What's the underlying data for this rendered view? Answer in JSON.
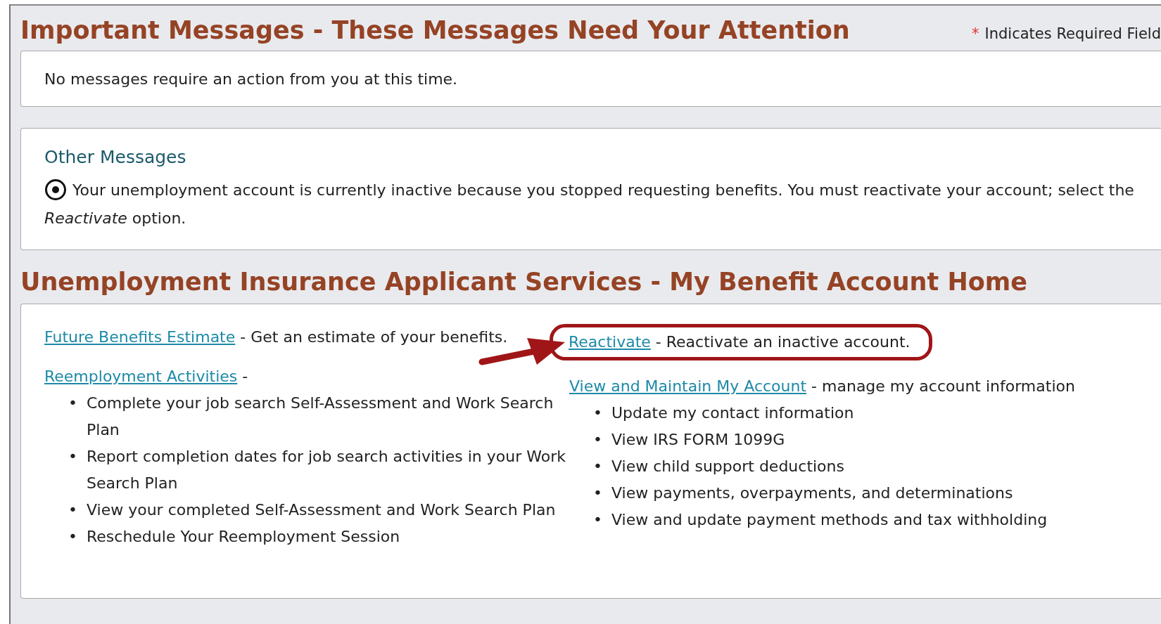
{
  "important": {
    "title": "Important Messages - These Messages Need Your Attention",
    "required_mark": "*",
    "required_note": "Indicates Required Field",
    "message": "No messages require an action from you at this time."
  },
  "other": {
    "title": "Other Messages",
    "items": [
      {
        "text": "Your unemployment account is currently inactive because you stopped requesting benefits. You must reactivate your account; select the *Reactivate* option."
      }
    ]
  },
  "services": {
    "bullet_mark": "•",
    "title": "Unemployment Insurance Applicant Services - My Benefit Account Home",
    "columns": [
      [
        {
          "link": "Future Benefits Estimate",
          "desc": "- Get an estimate of your benefits.",
          "highlighted": false
        },
        {
          "link": "Reemployment Activities",
          "desc": "-",
          "highlighted": false,
          "bullets": [
            "Complete your job search Self-Assessment and Work Search Plan",
            "Report completion dates for job search activities in your Work Search Plan",
            "View your completed Self-Assessment and Work Search Plan",
            "Reschedule Your Reemployment Session"
          ]
        }
      ],
      [
        {
          "link": "Reactivate",
          "desc": "- Reactivate an inactive account.",
          "highlighted": true
        },
        {
          "link": "View and Maintain My Account",
          "desc": "- manage my account information",
          "highlighted": false,
          "bullets": [
            "Update my contact information",
            "View IRS FORM 1099G",
            "View child support deductions",
            "View payments, overpayments, and determinations",
            "View and update payment methods and tax withholding"
          ]
        }
      ]
    ]
  }
}
